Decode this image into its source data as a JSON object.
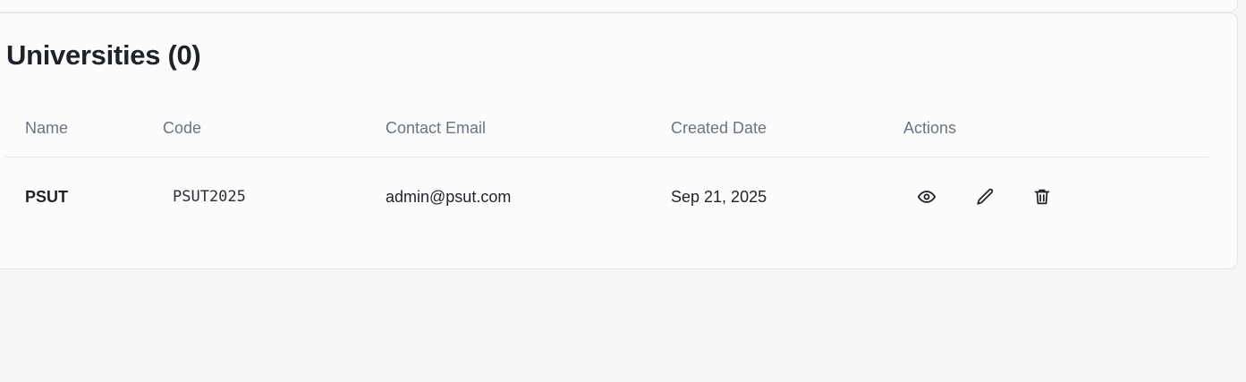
{
  "section": {
    "title": "Universities (0)"
  },
  "table": {
    "columns": [
      "Name",
      "Code",
      "Contact Email",
      "Created Date",
      "Actions"
    ],
    "rows": [
      {
        "name": "PSUT",
        "code": "PSUT2025",
        "email": "admin@psut.com",
        "created": "Sep 21, 2025",
        "actions": [
          "eye-icon",
          "pencil-icon",
          "trash-icon"
        ]
      }
    ]
  }
}
